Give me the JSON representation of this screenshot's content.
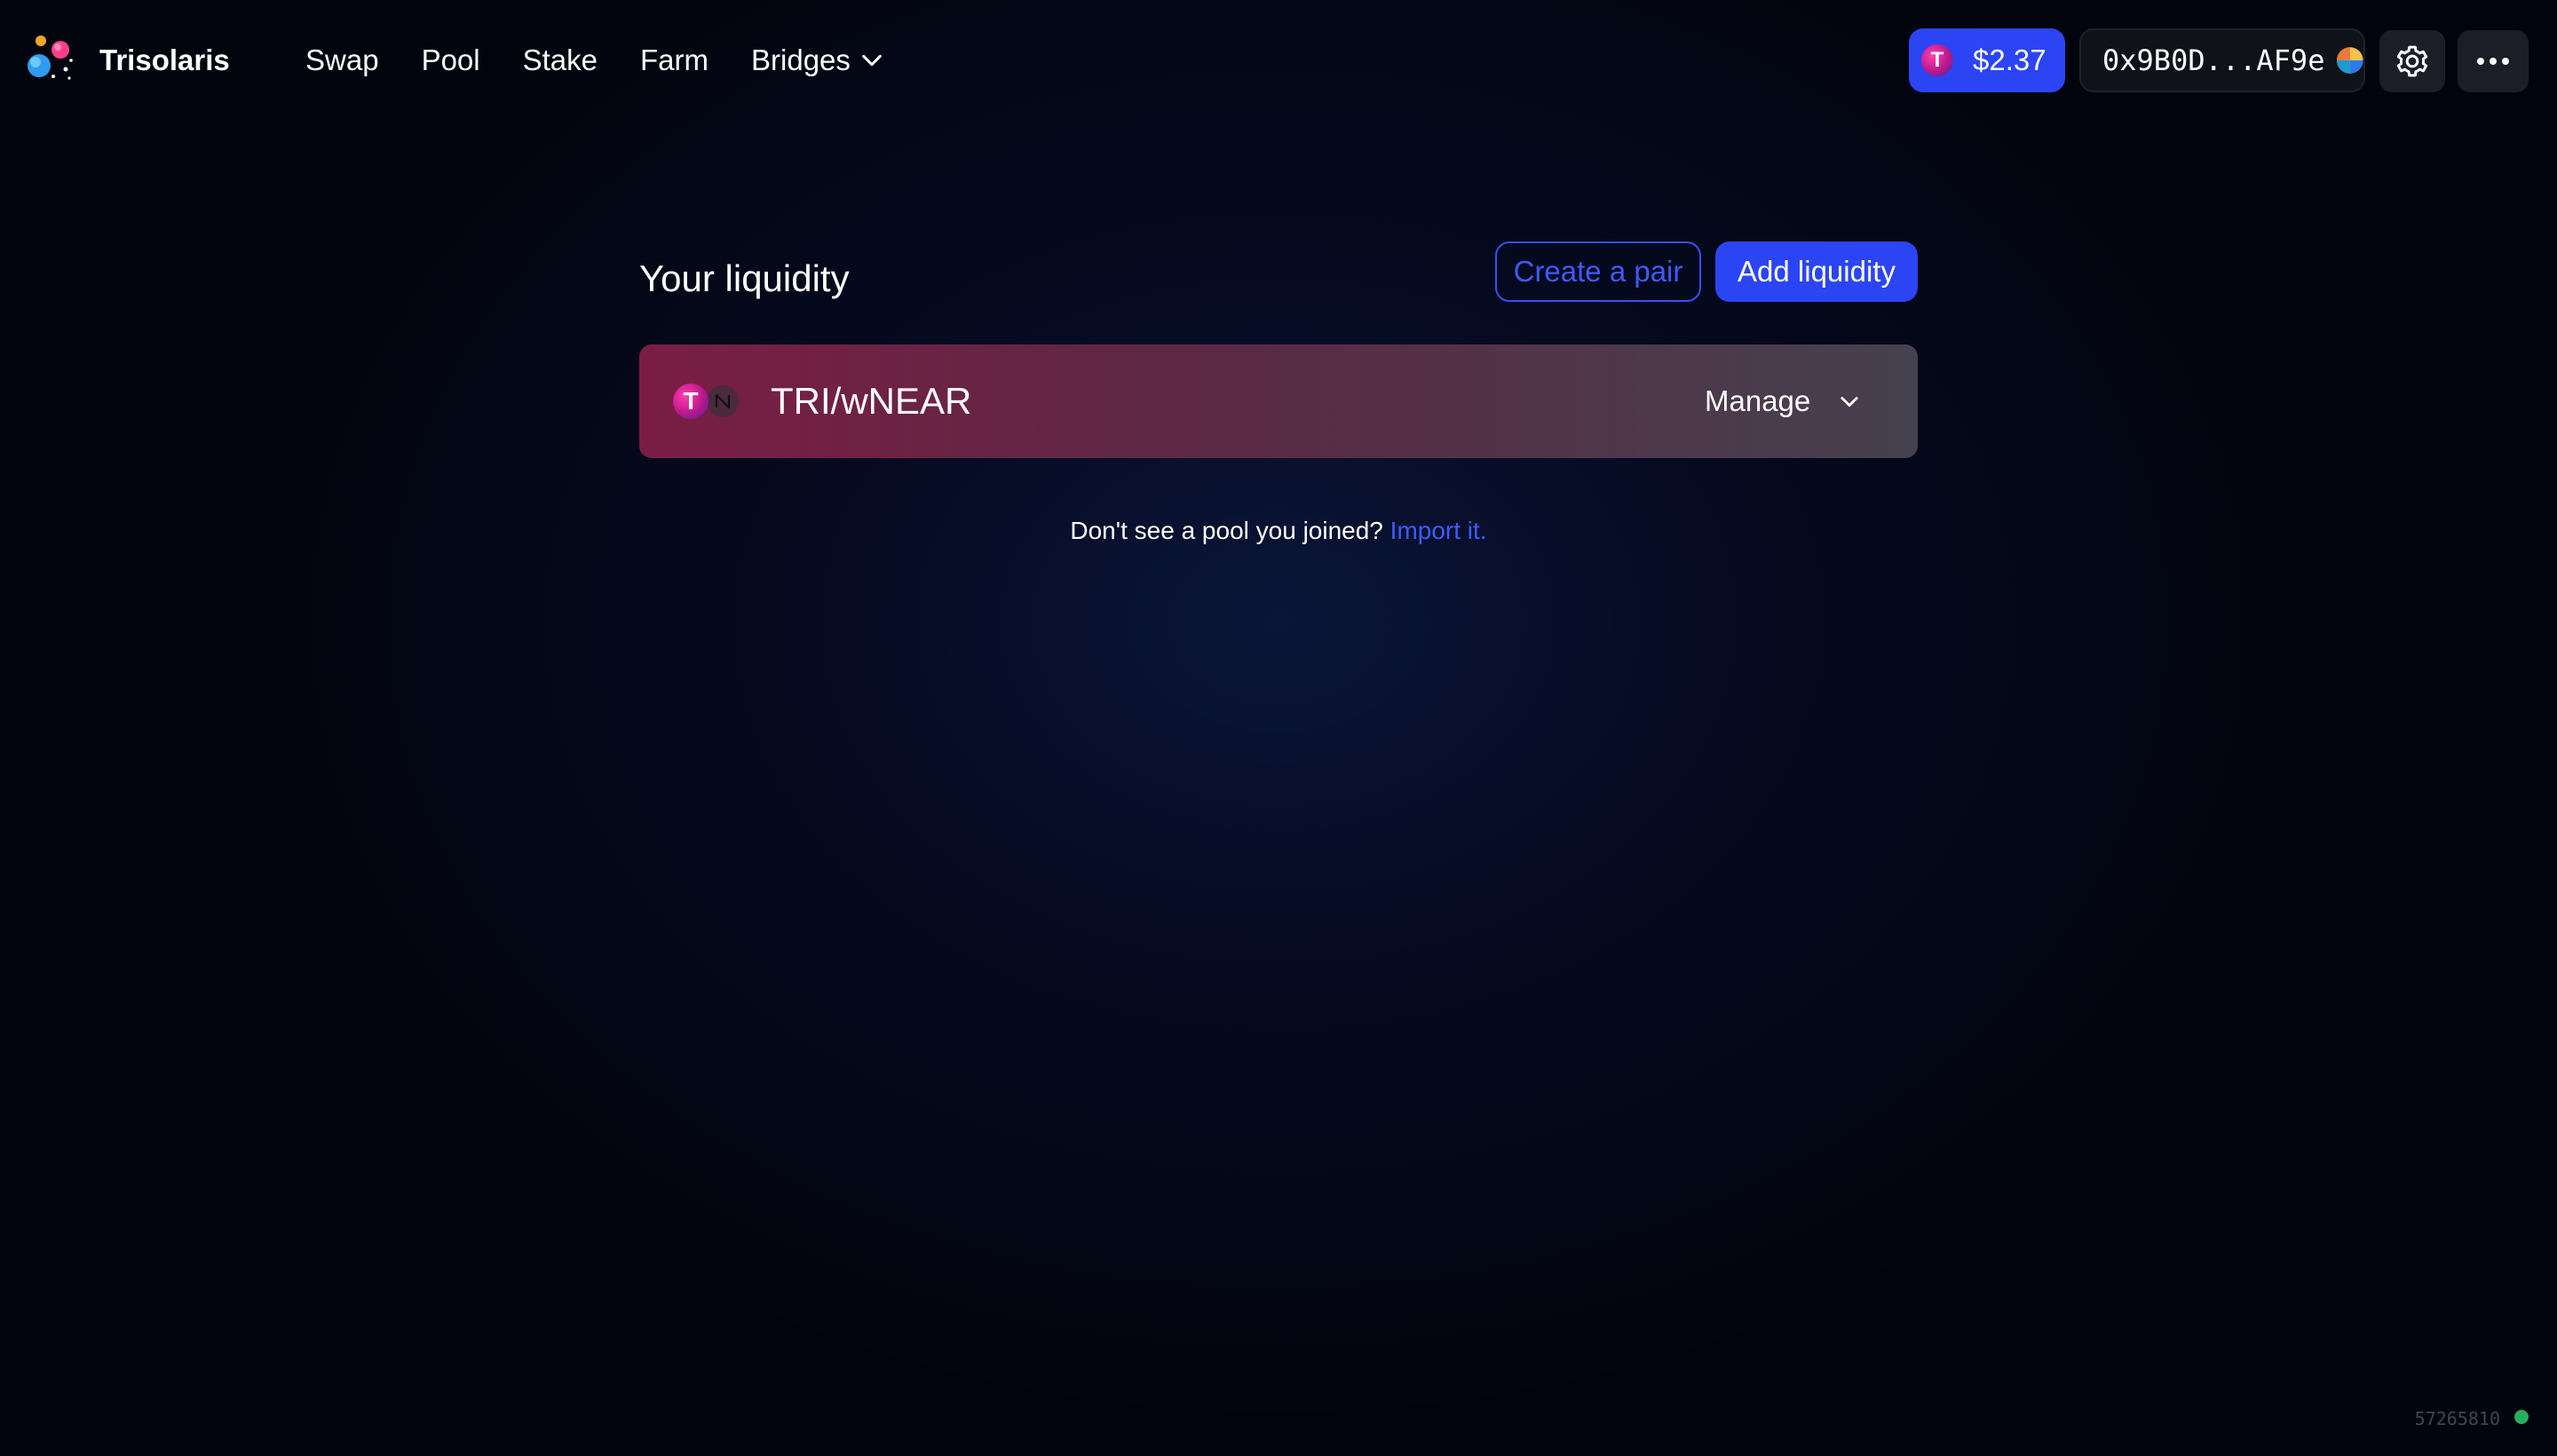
{
  "header": {
    "brand": "Trisolaris",
    "nav": [
      {
        "label": "Swap"
      },
      {
        "label": "Pool"
      },
      {
        "label": "Stake"
      },
      {
        "label": "Farm"
      },
      {
        "label": "Bridges"
      }
    ],
    "token_price": "$2.37",
    "token_icon_letter": "T",
    "wallet_address": "0x9B0D...AF9e"
  },
  "main": {
    "title": "Your liquidity",
    "create_pair_label": "Create a pair",
    "add_liquidity_label": "Add liquidity",
    "pools": [
      {
        "name": "TRI/wNEAR",
        "token0_letter": "T",
        "manage_label": "Manage"
      }
    ],
    "import_prompt": "Don't see a pool you joined?",
    "import_link": "Import it."
  },
  "footer": {
    "block_number": "57265810",
    "status_color": "#27ae60"
  },
  "colors": {
    "accent": "#2b45f5",
    "link": "#3d5bff",
    "pool_card_start": "#7a1d44",
    "pool_card_end": "#45414f"
  }
}
